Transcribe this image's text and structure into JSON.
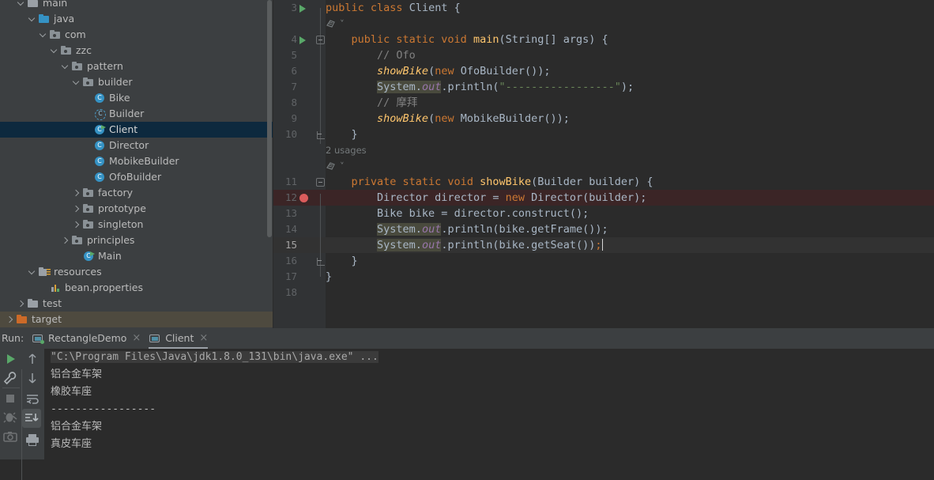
{
  "project_tree": {
    "items": [
      {
        "label": "main",
        "depth": 1,
        "arrow": "open",
        "icon": "folder",
        "state": "partial"
      },
      {
        "label": "java",
        "depth": 2,
        "arrow": "open",
        "icon": "folder-blue"
      },
      {
        "label": "com",
        "depth": 3,
        "arrow": "open",
        "icon": "package"
      },
      {
        "label": "zzc",
        "depth": 4,
        "arrow": "open",
        "icon": "package"
      },
      {
        "label": "pattern",
        "depth": 5,
        "arrow": "open",
        "icon": "package"
      },
      {
        "label": "builder",
        "depth": 6,
        "arrow": "open",
        "icon": "package"
      },
      {
        "label": "Bike",
        "depth": 7,
        "arrow": "none",
        "icon": "class"
      },
      {
        "label": "Builder",
        "depth": 7,
        "arrow": "none",
        "icon": "interface"
      },
      {
        "label": "Client",
        "depth": 7,
        "arrow": "none",
        "icon": "class-runnable",
        "selected": true
      },
      {
        "label": "Director",
        "depth": 7,
        "arrow": "none",
        "icon": "class"
      },
      {
        "label": "MobikeBuilder",
        "depth": 7,
        "arrow": "none",
        "icon": "class"
      },
      {
        "label": "OfoBuilder",
        "depth": 7,
        "arrow": "none",
        "icon": "class"
      },
      {
        "label": "factory",
        "depth": 6,
        "arrow": "closed",
        "icon": "package"
      },
      {
        "label": "prototype",
        "depth": 6,
        "arrow": "closed",
        "icon": "package"
      },
      {
        "label": "singleton",
        "depth": 6,
        "arrow": "closed",
        "icon": "package"
      },
      {
        "label": "principles",
        "depth": 5,
        "arrow": "closed",
        "icon": "package"
      },
      {
        "label": "Main",
        "depth": 6,
        "arrow": "none",
        "icon": "class-runnable"
      },
      {
        "label": "resources",
        "depth": 2,
        "arrow": "open",
        "icon": "folder-resources"
      },
      {
        "label": "bean.properties",
        "depth": 3,
        "arrow": "none",
        "icon": "properties"
      },
      {
        "label": "test",
        "depth": 1,
        "arrow": "closed",
        "icon": "folder"
      },
      {
        "label": "target",
        "depth": 0,
        "arrow": "closed",
        "icon": "folder-orange",
        "hover": true
      }
    ]
  },
  "editor": {
    "lines": [
      {
        "num": "3",
        "gutter": "run",
        "fold": "none",
        "segments": [
          {
            "t": "public ",
            "c": "kw"
          },
          {
            "t": "class ",
            "c": "kw"
          },
          {
            "t": "Client ",
            "c": "txt"
          },
          {
            "t": "{",
            "c": "txt"
          }
        ]
      },
      {
        "num": "",
        "gutter": "none",
        "fold": "none",
        "inlay": "icon-only",
        "segments": []
      },
      {
        "num": "4",
        "gutter": "run",
        "fold": "start",
        "segments": [
          {
            "t": "    ",
            "c": "txt"
          },
          {
            "t": "public static void ",
            "c": "kw"
          },
          {
            "t": "main",
            "c": "mth"
          },
          {
            "t": "(String[] args) {",
            "c": "txt"
          }
        ]
      },
      {
        "num": "5",
        "gutter": "none",
        "fold": "none",
        "segments": [
          {
            "t": "        ",
            "c": "txt"
          },
          {
            "t": "// Ofo",
            "c": "cmt"
          }
        ]
      },
      {
        "num": "6",
        "gutter": "none",
        "fold": "none",
        "segments": [
          {
            "t": "        ",
            "c": "txt"
          },
          {
            "t": "showBike",
            "c": "mthi"
          },
          {
            "t": "(",
            "c": "txt"
          },
          {
            "t": "new ",
            "c": "kw"
          },
          {
            "t": "OfoBuilder());",
            "c": "txt"
          }
        ]
      },
      {
        "num": "7",
        "gutter": "none",
        "fold": "none",
        "segments": [
          {
            "t": "        ",
            "c": "txt"
          },
          {
            "t": "System.",
            "c": "txt hl"
          },
          {
            "t": "out",
            "c": "fld hl"
          },
          {
            "t": ".println(",
            "c": "txt"
          },
          {
            "t": "\"-----------------\"",
            "c": "str"
          },
          {
            "t": ");",
            "c": "txt"
          }
        ]
      },
      {
        "num": "8",
        "gutter": "none",
        "fold": "none",
        "segments": [
          {
            "t": "        ",
            "c": "txt"
          },
          {
            "t": "// 摩拜",
            "c": "cmt"
          }
        ]
      },
      {
        "num": "9",
        "gutter": "none",
        "fold": "none",
        "segments": [
          {
            "t": "        ",
            "c": "txt"
          },
          {
            "t": "showBike",
            "c": "mthi"
          },
          {
            "t": "(",
            "c": "txt"
          },
          {
            "t": "new ",
            "c": "kw"
          },
          {
            "t": "MobikeBuilder());",
            "c": "txt"
          }
        ]
      },
      {
        "num": "10",
        "gutter": "none",
        "fold": "end",
        "segments": [
          {
            "t": "    }",
            "c": "txt"
          }
        ]
      },
      {
        "num": "",
        "gutter": "none",
        "fold": "none",
        "inlay": "2 usages",
        "segments": []
      },
      {
        "num": "",
        "gutter": "none",
        "fold": "none",
        "inlay": "icon-only",
        "segments": []
      },
      {
        "num": "11",
        "gutter": "none",
        "fold": "start",
        "segments": [
          {
            "t": "    ",
            "c": "txt"
          },
          {
            "t": "private static void ",
            "c": "kw"
          },
          {
            "t": "showBike",
            "c": "mth"
          },
          {
            "t": "(Builder builder) {",
            "c": "txt"
          }
        ]
      },
      {
        "num": "12",
        "gutter": "breakpoint",
        "fold": "none",
        "rowstyle": "bp",
        "segments": [
          {
            "t": "        ",
            "c": "txt"
          },
          {
            "t": "Director director = ",
            "c": "txt"
          },
          {
            "t": "new ",
            "c": "kw"
          },
          {
            "t": "Director(builder);",
            "c": "txt"
          }
        ]
      },
      {
        "num": "13",
        "gutter": "none",
        "fold": "none",
        "segments": [
          {
            "t": "        ",
            "c": "txt"
          },
          {
            "t": "Bike bike = director.construct();",
            "c": "txt"
          }
        ]
      },
      {
        "num": "14",
        "gutter": "none",
        "fold": "none",
        "segments": [
          {
            "t": "        ",
            "c": "txt"
          },
          {
            "t": "System.",
            "c": "txt hl"
          },
          {
            "t": "out",
            "c": "fld hl"
          },
          {
            "t": ".println(bike.getFrame());",
            "c": "txt"
          }
        ]
      },
      {
        "num": "15",
        "gutter": "none",
        "fold": "none",
        "rowstyle": "caret",
        "current": true,
        "segments": [
          {
            "t": "        ",
            "c": "txt"
          },
          {
            "t": "System.",
            "c": "txt hl"
          },
          {
            "t": "out",
            "c": "fld hl"
          },
          {
            "t": ".println(bike.getSeat())",
            "c": "txt"
          },
          {
            "t": ";",
            "c": "kw"
          }
        ]
      },
      {
        "num": "16",
        "gutter": "none",
        "fold": "end",
        "segments": [
          {
            "t": "    }",
            "c": "txt"
          }
        ]
      },
      {
        "num": "17",
        "gutter": "none",
        "fold": "none",
        "segments": [
          {
            "t": "}",
            "c": "txt"
          }
        ]
      },
      {
        "num": "18",
        "gutter": "none",
        "fold": "none",
        "segments": []
      }
    ]
  },
  "run_panel": {
    "label": "Run:",
    "tabs": [
      {
        "label": "RectangleDemo",
        "active": false,
        "running": true,
        "close": "×"
      },
      {
        "label": "Client",
        "active": true,
        "running": false,
        "close": "×"
      }
    ],
    "toolbar_left": [
      "rerun-icon",
      "settings-icon",
      "stop-icon",
      "debug-icon",
      "camera-icon"
    ],
    "toolbar_right": [
      "scroll-up-icon",
      "scroll-down-icon",
      "soft-wrap-icon",
      "scroll-to-end-icon",
      "print-icon"
    ],
    "console_lines": [
      {
        "text": "\"C:\\Program Files\\Java\\jdk1.8.0_131\\bin\\java.exe\" ...",
        "type": "cmd"
      },
      {
        "text": "铝合金车架",
        "type": "out"
      },
      {
        "text": "橡胶车座",
        "type": "out"
      },
      {
        "text": "-----------------",
        "type": "out"
      },
      {
        "text": "铝合金车架",
        "type": "out"
      },
      {
        "text": "真皮车座",
        "type": "out"
      }
    ]
  },
  "colors": {
    "panel_bg": "#3c3f41",
    "editor_bg": "#2b2b2b",
    "gutter_bg": "#313335",
    "selection": "#0d293e",
    "hover_row": "#4e4a3f",
    "breakpoint": "#db5c5c",
    "run_green": "#59a869",
    "keyword": "#cc7832",
    "string": "#6a8759",
    "comment": "#808080",
    "method": "#ffc66d",
    "field": "#9876aa",
    "text": "#a9b7c6"
  }
}
